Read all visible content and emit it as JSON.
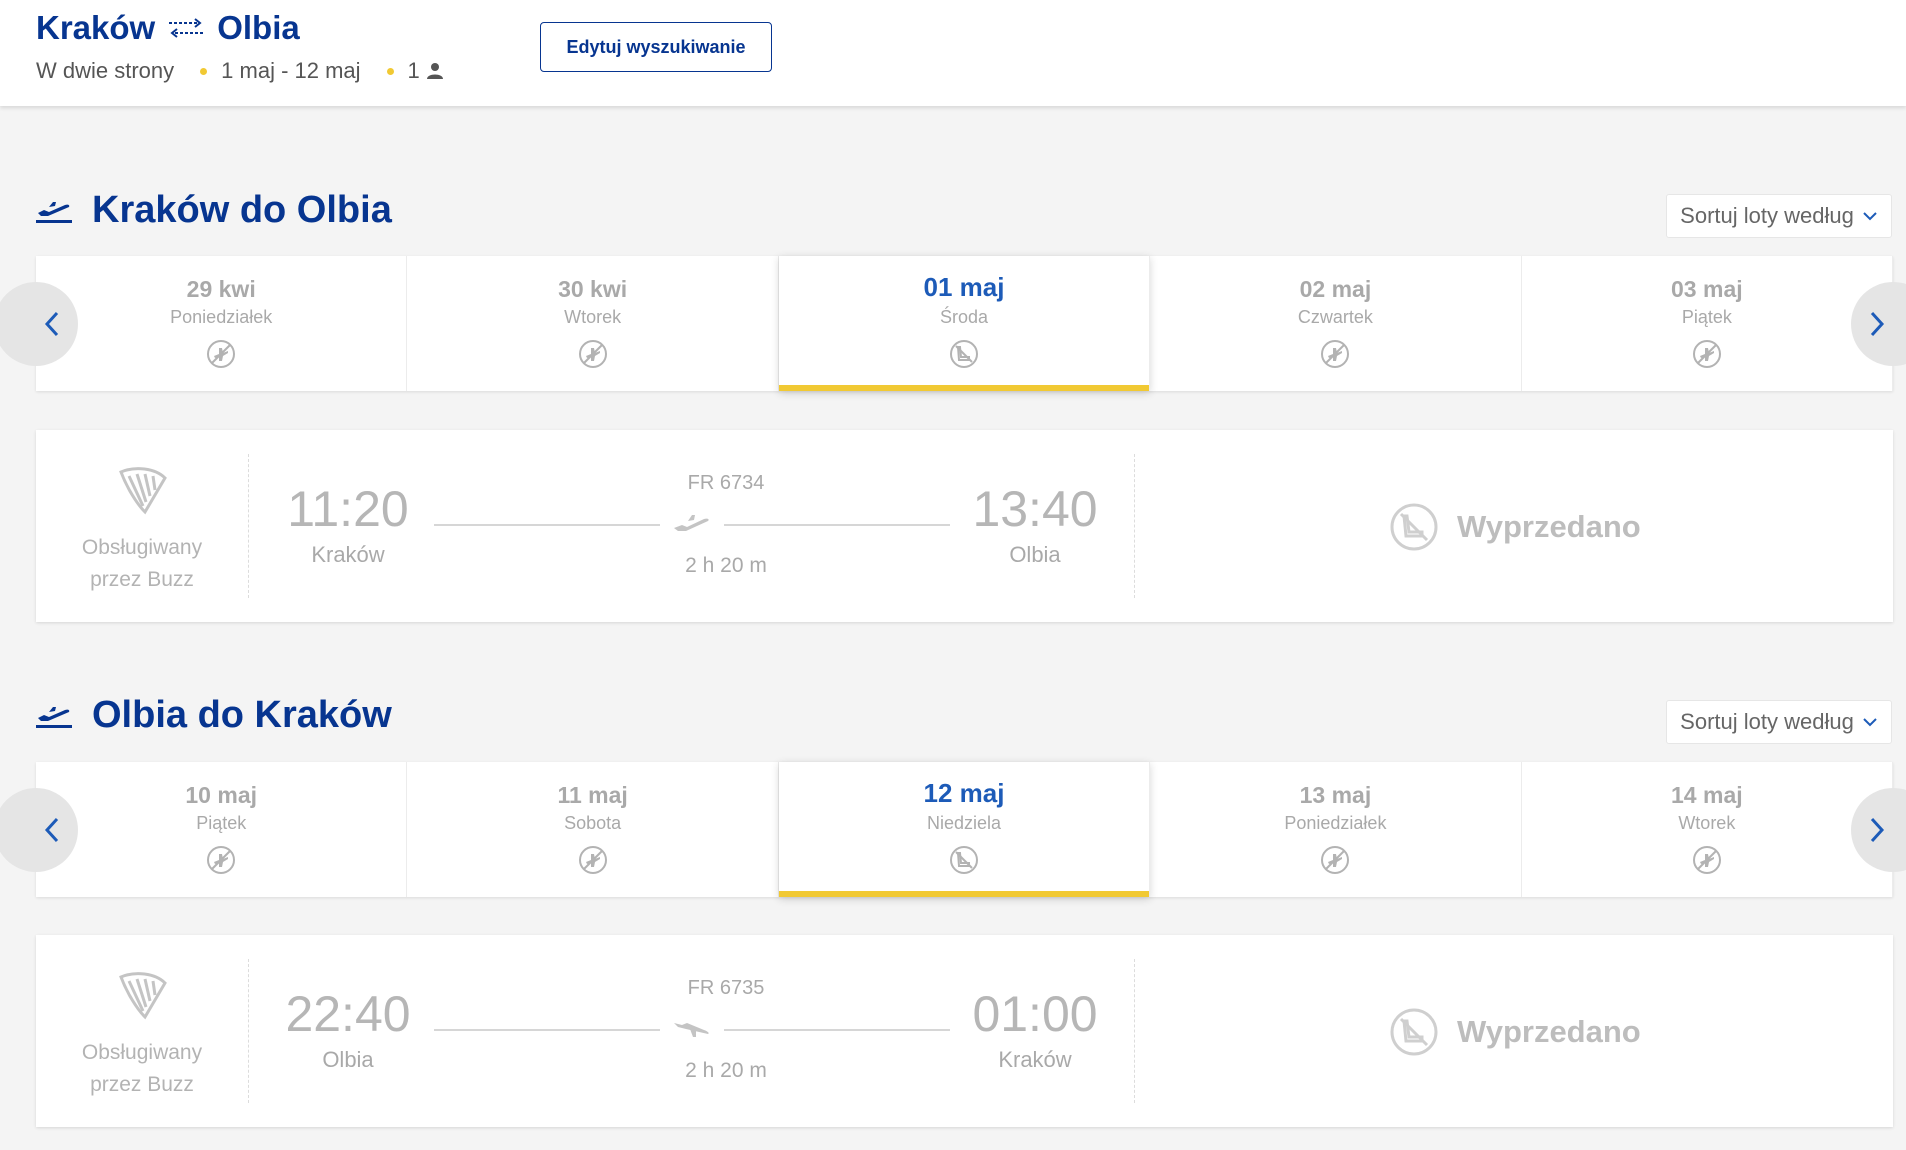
{
  "header": {
    "origin": "Kraków",
    "destination": "Olbia",
    "trip_type": "W dwie strony",
    "date_range": "1 maj - 12 maj",
    "passengers": "1",
    "edit_label": "Edytuj wyszukiwanie"
  },
  "outbound": {
    "title": "Kraków do Olbia",
    "sort_label": "Sortuj loty według",
    "days": [
      {
        "date": "29 kwi",
        "weekday": "Poniedziałek",
        "selected": false
      },
      {
        "date": "30 kwi",
        "weekday": "Wtorek",
        "selected": false
      },
      {
        "date": "01 maj",
        "weekday": "Środa",
        "selected": true
      },
      {
        "date": "02 maj",
        "weekday": "Czwartek",
        "selected": false
      },
      {
        "date": "03 maj",
        "weekday": "Piątek",
        "selected": false
      }
    ],
    "flight": {
      "operator_line1": "Obsługiwany",
      "operator_line2": "przez Buzz",
      "dep_time": "11:20",
      "dep_city": "Kraków",
      "flight_number": "FR 6734",
      "duration": "2 h 20 m",
      "arr_time": "13:40",
      "arr_city": "Olbia",
      "status": "Wyprzedano"
    }
  },
  "inbound": {
    "title": "Olbia do Kraków",
    "sort_label": "Sortuj loty według",
    "days": [
      {
        "date": "10 maj",
        "weekday": "Piątek",
        "selected": false
      },
      {
        "date": "11 maj",
        "weekday": "Sobota",
        "selected": false
      },
      {
        "date": "12 maj",
        "weekday": "Niedziela",
        "selected": true
      },
      {
        "date": "13 maj",
        "weekday": "Poniedziałek",
        "selected": false
      },
      {
        "date": "14 maj",
        "weekday": "Wtorek",
        "selected": false
      }
    ],
    "flight": {
      "operator_line1": "Obsługiwany",
      "operator_line2": "przez Buzz",
      "dep_time": "22:40",
      "dep_city": "Olbia",
      "flight_number": "FR 6735",
      "duration": "2 h 20 m",
      "arr_time": "01:00",
      "arr_city": "Kraków",
      "status": "Wyprzedano"
    }
  },
  "icons": {
    "swap": "round-trip-arrows-icon",
    "person": "person-icon",
    "departure": "plane-takeoff-icon",
    "no_flight": "no-flights-icon",
    "sold_out": "sold-out-seat-icon",
    "logo": "ryanair-harp-logo"
  },
  "colors": {
    "brand_blue": "#073590",
    "selected_date": "#1d5bb8",
    "accent_yellow": "#f1c933",
    "muted": "#a9a9a9"
  }
}
